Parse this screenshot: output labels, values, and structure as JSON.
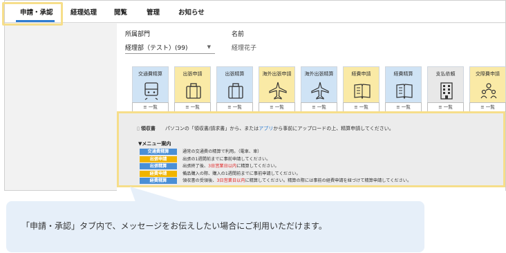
{
  "tabs": [
    {
      "label": "申請・承認",
      "active": true
    },
    {
      "label": "経理処理",
      "active": false
    },
    {
      "label": "閲覧",
      "active": false
    },
    {
      "label": "管理",
      "active": false
    },
    {
      "label": "お知らせ",
      "active": false
    }
  ],
  "form": {
    "dept_label": "所属部門",
    "dept_value": "経理部（テスト）(99)",
    "name_label": "名前",
    "name_value": "経理花子"
  },
  "tiles": [
    {
      "label": "交通費精算",
      "color": "blue",
      "icon": "train-icon"
    },
    {
      "label": "出張申請",
      "color": "yellow",
      "icon": "suitcase-icon"
    },
    {
      "label": "出張精算",
      "color": "blue",
      "icon": "suitcase-icon"
    },
    {
      "label": "海外出張申請",
      "color": "yellow",
      "icon": "airplane-icon"
    },
    {
      "label": "海外出張精算",
      "color": "blue",
      "icon": "airplane-icon"
    },
    {
      "label": "経費申請",
      "color": "yellow",
      "icon": "book-icon"
    },
    {
      "label": "経費精算",
      "color": "blue",
      "icon": "book-icon"
    },
    {
      "label": "支払依頼",
      "color": "gray",
      "icon": "building-icon"
    },
    {
      "label": "交際費申請",
      "color": "yellow",
      "icon": "people-icon"
    }
  ],
  "list_button_label": "≡ 一覧",
  "message": {
    "receipt_label": "領収書",
    "receipt_text_before": "パソコンの「領収書/請求書」から、または",
    "receipt_link": "アプリ",
    "receipt_text_after": "から事前にアップロードの上、精算申請してください。",
    "menu_title": "▼メニュー案内",
    "rows": [
      {
        "badge": "交通費精算",
        "color": "#4a8fd6",
        "before": "通常の交通費の精算で利用。（電車、車）",
        "red": "",
        "after": ""
      },
      {
        "badge": "出張申請",
        "color": "#f0b400",
        "before": "出張の1週間前までに事前申請してください。",
        "red": "",
        "after": ""
      },
      {
        "badge": "出張精算",
        "color": "#4a8fd6",
        "before": "出張終了後、",
        "red": "3日営業日以内",
        "after": "に精算してください。"
      },
      {
        "badge": "経費申請",
        "color": "#f0b400",
        "before": "備品購入の際、購入の1週間前までに事前申請してください。",
        "red": "",
        "after": ""
      },
      {
        "badge": "経費精算",
        "color": "#4a8fd6",
        "before": "領収書の受領後、",
        "red": "3日営業日以内",
        "after": "に精算してください。精算の際には事前の経費申請を紐づけて精算申請してください。"
      }
    ]
  },
  "callout": {
    "text": "「申請・承認」タブ内で、メッセージをお伝えしたい場合にご利用いただけます。"
  },
  "colors": {
    "accent": "#2f7dd1",
    "highlight": "#f6de8a",
    "tile_blue": "#cfe3f5",
    "tile_yellow": "#faeaa6",
    "callout_bg": "#e6eff9"
  }
}
